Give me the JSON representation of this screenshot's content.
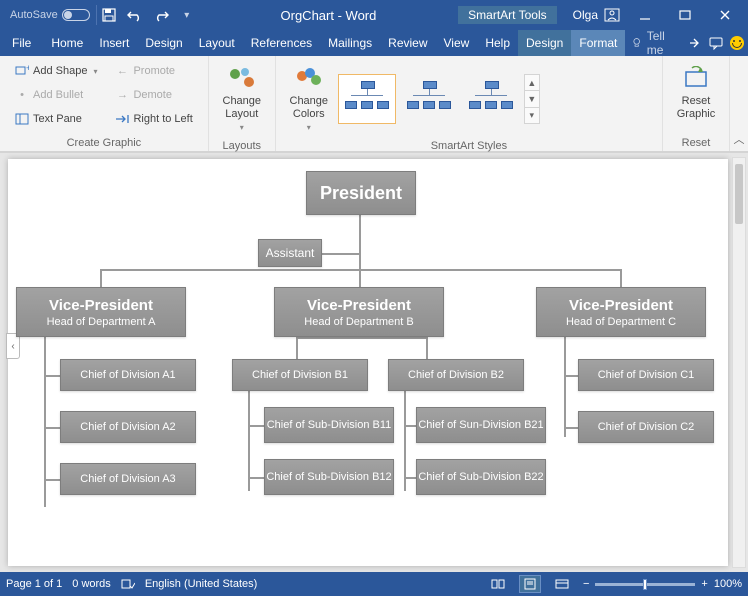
{
  "titlebar": {
    "autosave_label": "AutoSave",
    "doc_title": "OrgChart - Word",
    "contextual_tab": "SmartArt Tools",
    "user_name": "Olga"
  },
  "tabs": {
    "file": "File",
    "home": "Home",
    "insert": "Insert",
    "design0": "Design",
    "layout": "Layout",
    "references": "References",
    "mailings": "Mailings",
    "review": "Review",
    "view": "View",
    "help": "Help",
    "design": "Design",
    "format": "Format",
    "tellme": "Tell me"
  },
  "ribbon": {
    "create": {
      "add_shape": "Add Shape",
      "add_bullet": "Add Bullet",
      "text_pane": "Text Pane",
      "promote": "Promote",
      "demote": "Demote",
      "rtl": "Right to Left",
      "label": "Create Graphic"
    },
    "layouts": {
      "change": "Change Layout",
      "label": "Layouts"
    },
    "styles": {
      "change_colors": "Change Colors",
      "label": "SmartArt Styles"
    },
    "reset": {
      "reset": "Reset Graphic",
      "label": "Reset"
    }
  },
  "chart": {
    "president": "President",
    "assistant": "Assistant",
    "vp": [
      {
        "title": "Vice-President",
        "sub": "Head of Department A"
      },
      {
        "title": "Vice-President",
        "sub": "Head of Department B"
      },
      {
        "title": "Vice-President",
        "sub": "Head of Department C"
      }
    ],
    "div": {
      "a1": "Chief of Division A1",
      "a2": "Chief of Division A2",
      "a3": "Chief of Division A3",
      "b1": "Chief of Division B1",
      "b2": "Chief of Division B2",
      "b11": "Chief of Sub-Division B11",
      "b12": "Chief of Sub-Division B12",
      "b21": "Chief of Sun-Division B21",
      "b22": "Chief of Sub-Division B22",
      "c1": "Chief of Division C1",
      "c2": "Chief of Division C2"
    }
  },
  "status": {
    "page": "Page 1 of 1",
    "words": "0 words",
    "language": "English (United States)",
    "zoom": "100%"
  }
}
